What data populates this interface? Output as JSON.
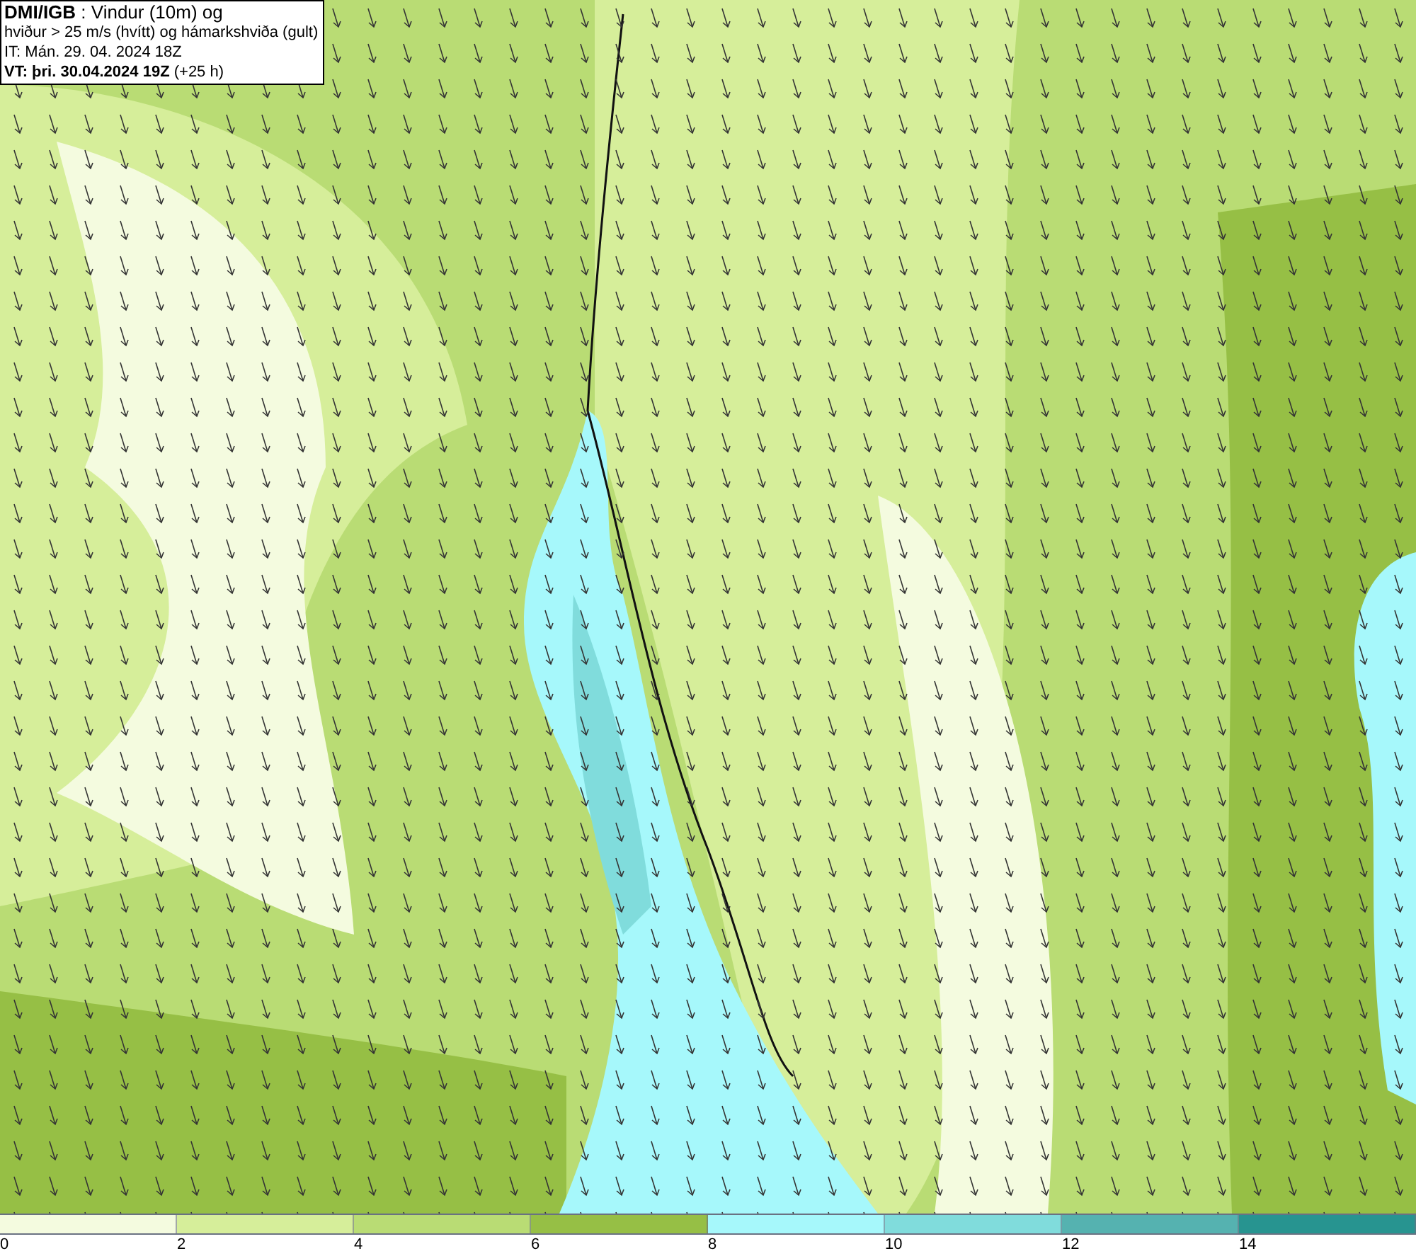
{
  "info_box": {
    "lines": [
      "**DMI/IGB** : Vindur (10m) og",
      "hviður > 25 m/s (hvítt) og hámarkshviða (gult)",
      "IT: Mán. 29. 04. 2024 18Z",
      "**VT: þri. 30.04.2024 19Z** (+25 h)"
    ]
  },
  "legend": {
    "segments": [
      {
        "label": "0",
        "color": "#f4fbdf"
      },
      {
        "label": "2",
        "color": "#d6ee9a"
      },
      {
        "label": "4",
        "color": "#b9dc74"
      },
      {
        "label": "6",
        "color": "#96bf45"
      },
      {
        "label": "8",
        "color": "#a6f8fb"
      },
      {
        "label": "10",
        "color": "#80dcdc"
      },
      {
        "label": "12",
        "color": "#55b2b0"
      },
      {
        "label": "14",
        "color": "#279490"
      }
    ]
  }
}
